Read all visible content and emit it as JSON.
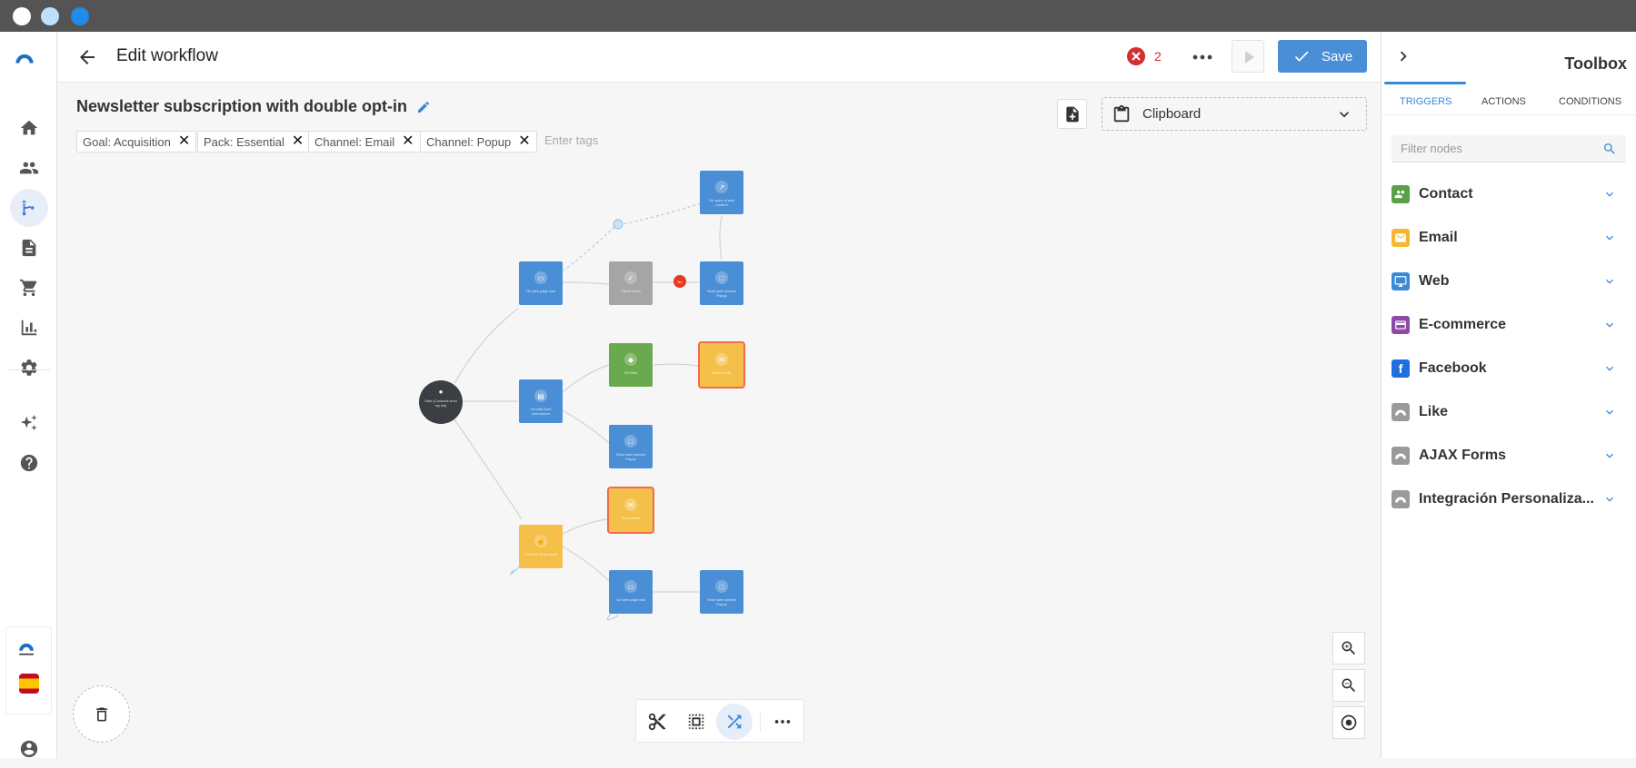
{
  "window": {
    "dot_colors": [
      "#ffffff",
      "#bfe0fb",
      "#1e8ce8"
    ]
  },
  "header": {
    "title": "Edit workflow",
    "error_count": "2",
    "save_label": "Save"
  },
  "workflow": {
    "name": "Newsletter subscription with double opt-in",
    "tags": [
      "Goal: Acquisition",
      "Pack: Essential",
      "Channel: Email",
      "Channel: Popup"
    ],
    "tags_placeholder": "Enter tags",
    "clipboard_label": "Clipboard"
  },
  "nodes": {
    "start": "Start (Contacts from my list)",
    "on_web_visit_1": "On web page visit",
    "check_value": "Check value",
    "no_badge": "No",
    "send_popup_1": "Send web content Popup",
    "on_open_popup": "On open of web content",
    "on_form_submission": "On web form submission",
    "set_field": "Set field",
    "send_email_1": "Send Email",
    "send_popup_2": "Send web content Popup",
    "on_click_email": "On click of an email",
    "send_email_2": "Send Email",
    "on_web_visit_2": "On web page visit",
    "send_popup_3": "Send web content Popup"
  },
  "toolbox": {
    "title": "Toolbox",
    "tabs": [
      "TRIGGERS",
      "ACTIONS",
      "CONDITIONS"
    ],
    "filter_placeholder": "Filter nodes",
    "items": [
      {
        "label": "Contact",
        "color": "#5aa04a",
        "icon": "people-icon"
      },
      {
        "label": "Email",
        "color": "#f5b731",
        "icon": "email-icon"
      },
      {
        "label": "Web",
        "color": "#3a8ad6",
        "icon": "monitor-icon"
      },
      {
        "label": "E-commerce",
        "color": "#8e4aa8",
        "icon": "card-icon"
      },
      {
        "label": "Facebook",
        "color": "#1e6fe0",
        "icon": "facebook-icon"
      },
      {
        "label": "Like",
        "color": "#9a9a9a",
        "icon": "connectif-icon"
      },
      {
        "label": "AJAX Forms",
        "color": "#9a9a9a",
        "icon": "connectif-icon"
      },
      {
        "label": "Integración Personaliza...",
        "color": "#9a9a9a",
        "icon": "connectif-icon"
      }
    ]
  },
  "colors": {
    "accent": "#3a8ad6",
    "save_button": "#4a8fd6",
    "error": "#d0302f"
  }
}
